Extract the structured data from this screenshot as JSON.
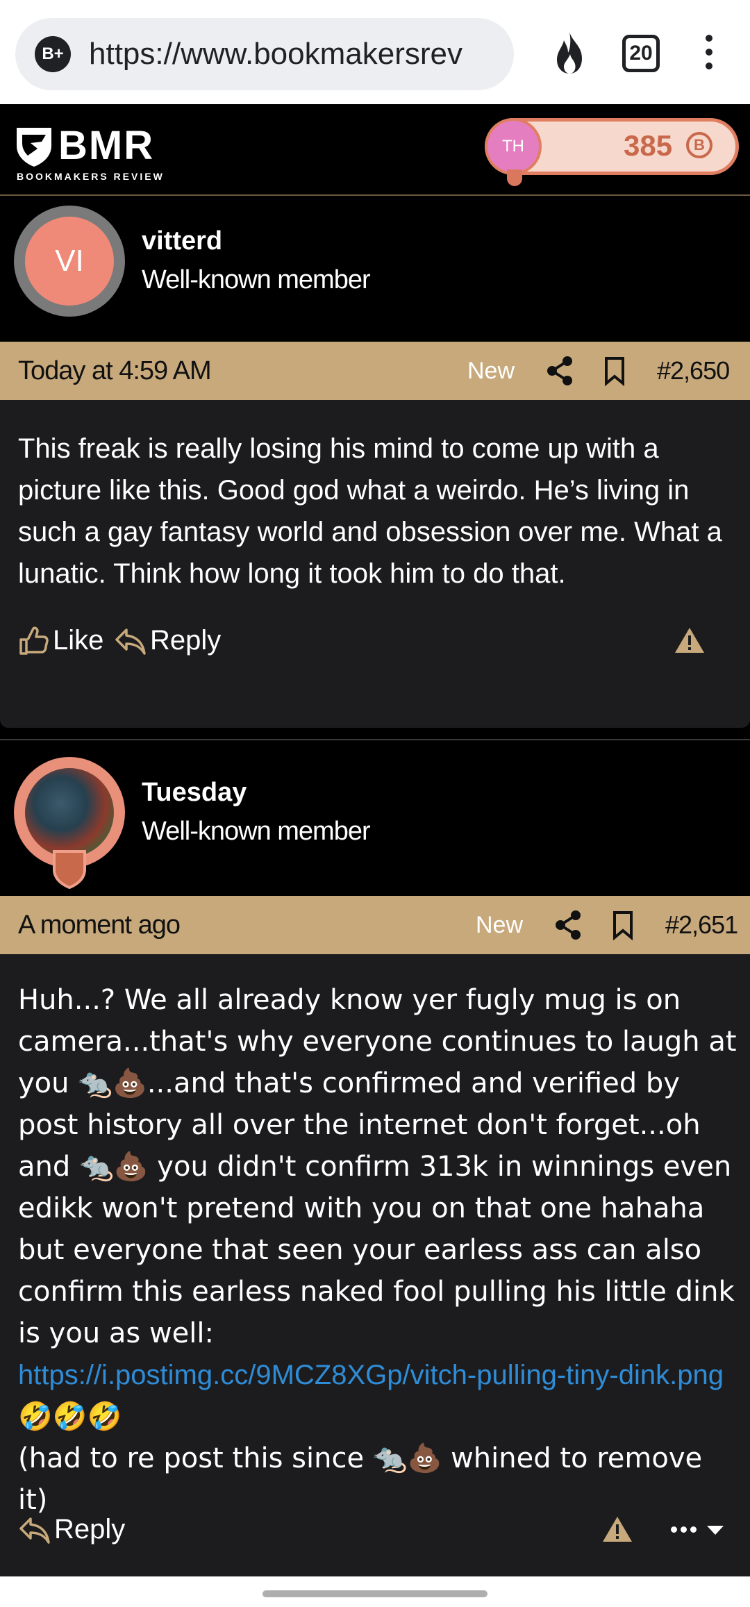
{
  "browser": {
    "site_badge": "B+",
    "url": "https://www.bookmakersrev",
    "tab_count": "20"
  },
  "header": {
    "logo_text": "BMR",
    "logo_subtext": "BOOKMAKERS REVIEW",
    "user_initials": "TH",
    "points": "385",
    "coin_symbol": "B"
  },
  "posts": [
    {
      "avatar_initials": "VI",
      "username": "vitterd",
      "user_title": "Well-known member",
      "time": "Today at 4:59 AM",
      "new_label": "New",
      "post_number": "#2,650",
      "body": "This freak is really losing his mind to come up with a picture like this. Good god what a weirdo. He’s living in such a gay fantasy world and obsession over me. What a lunatic. Think how long it took him to do that.",
      "like_label": "Like",
      "reply_label": "Reply"
    },
    {
      "username": "Tuesday",
      "user_title": "Well-known member",
      "time": "A moment ago",
      "new_label": "New",
      "post_number": "#2,651",
      "body_part1": "Huh...? We all already know yer fugly mug is on camera...that's why everyone continues to laugh at you 🐀💩...and that's confirmed and verified by post history all over the internet don't forget...oh and 🐀💩 you didn't confirm 313k in winnings even edikk won't pretend with you on that one hahaha but everyone that seen your earless ass can also confirm this earless naked fool pulling his little dink is you as well:",
      "link": "https://i.postimg.cc/9MCZ8XGp/vitch-pulling-tiny-dink.png",
      "laugh_emojis": "🤣🤣🤣",
      "body_part2": "(had to re post this since 🐀💩 whined to remove it)",
      "reply_label": "Reply"
    }
  ]
}
